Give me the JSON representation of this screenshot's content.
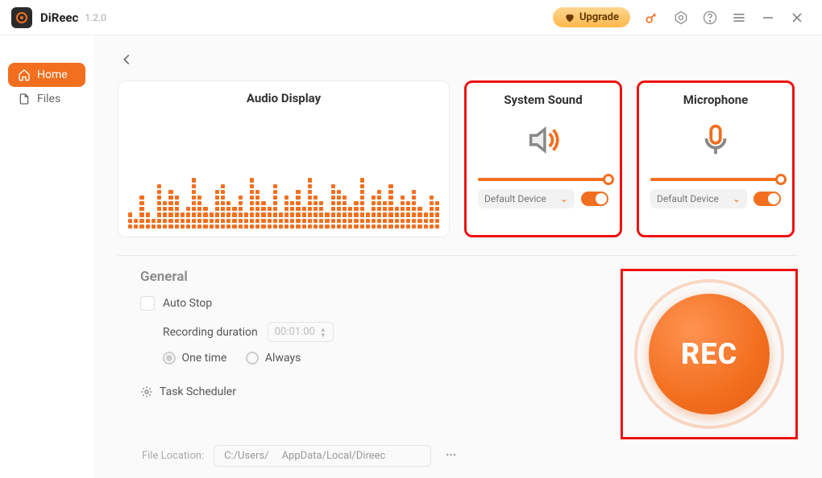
{
  "app": {
    "name": "DiReec",
    "version": "1.2.0",
    "upgrade_label": "Upgrade"
  },
  "sidebar": {
    "items": [
      {
        "label": "Home",
        "icon": "home-icon"
      },
      {
        "label": "Files",
        "icon": "file-icon"
      }
    ]
  },
  "panels": {
    "audio_display": {
      "title": "Audio Display"
    },
    "system_sound": {
      "title": "System Sound",
      "device": "Default Device",
      "volume": 100,
      "enabled": true
    },
    "microphone": {
      "title": "Microphone",
      "device": "Default Device",
      "volume": 100,
      "enabled": true
    }
  },
  "general": {
    "heading": "General",
    "auto_stop_label": "Auto Stop",
    "auto_stop_checked": false,
    "recording_duration_label": "Recording duration",
    "recording_duration_value": "00:01:00",
    "mode_options": {
      "one_time": "One time",
      "always": "Always"
    },
    "mode_selected": "one_time",
    "task_scheduler_label": "Task Scheduler"
  },
  "record": {
    "button_label": "REC"
  },
  "file_location": {
    "label": "File Location:",
    "path_prefix": "C:/Users/",
    "path_suffix": "AppData/Local/Direec"
  },
  "equalizer_heights": [
    3,
    2,
    6,
    3,
    2,
    8,
    5,
    7,
    6,
    3,
    4,
    9,
    6,
    4,
    3,
    7,
    8,
    5,
    4,
    6,
    3,
    9,
    7,
    5,
    4,
    8,
    3,
    6,
    5,
    7,
    4,
    9,
    6,
    5,
    3,
    8,
    7,
    6,
    4,
    5,
    9,
    3,
    6,
    7,
    5,
    8,
    4,
    6,
    5,
    7,
    4,
    3,
    6,
    5
  ]
}
